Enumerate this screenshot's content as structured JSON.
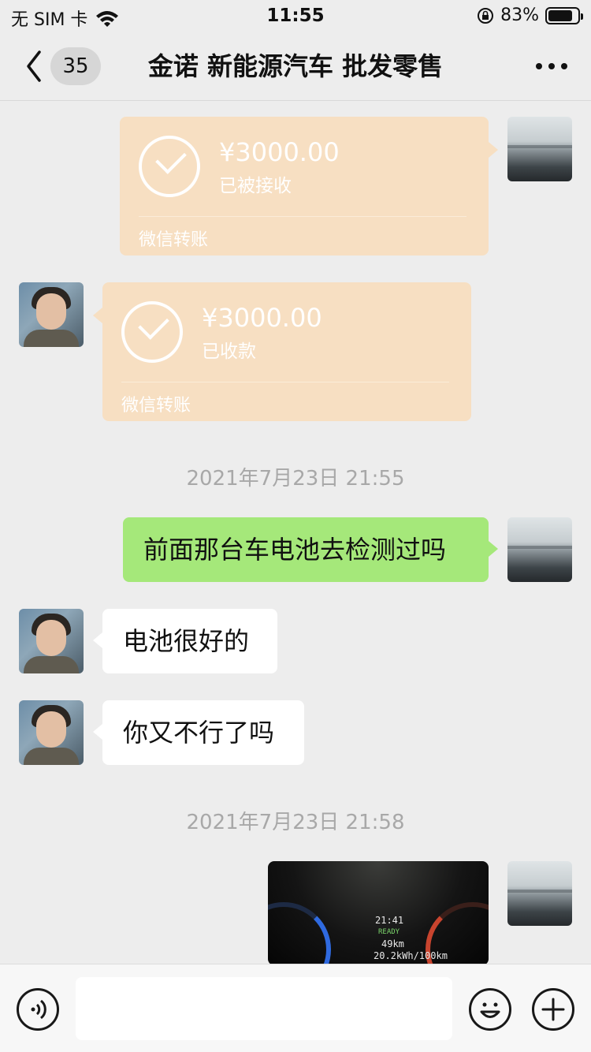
{
  "status_bar": {
    "carrier": "无 SIM 卡",
    "time": "11:55",
    "battery_percent": "83%",
    "battery_level": 0.83
  },
  "nav": {
    "unread_count": "35",
    "title": "金诺 新能源汽车 批发零售"
  },
  "messages": {
    "transfer_sent": {
      "amount": "¥3000.00",
      "status": "已被接收",
      "caption": "微信转账"
    },
    "transfer_received": {
      "amount": "¥3000.00",
      "status": "已收款",
      "caption": "微信转账"
    },
    "time_1": "2021年7月23日 21:55",
    "msg_1": "前面那台车电池去检测过吗",
    "msg_2": "电池很好的",
    "msg_3": "你又不行了吗",
    "time_2": "2021年7月23日 21:58"
  },
  "image_message": {
    "dash_clock": "21:41",
    "dash_ready": "READY",
    "dash_range": "49km",
    "dash_consumption": "20.2kWh/100km"
  },
  "colors": {
    "background": "#ededed",
    "sent_bubble": "#a5e87a",
    "transfer_card": "#f7dfc2"
  },
  "icons": [
    "wifi-icon",
    "rotation-lock-icon",
    "battery-icon",
    "back-chevron-icon",
    "more-icon",
    "voice-icon",
    "emoji-icon",
    "plus-icon",
    "check-icon"
  ]
}
